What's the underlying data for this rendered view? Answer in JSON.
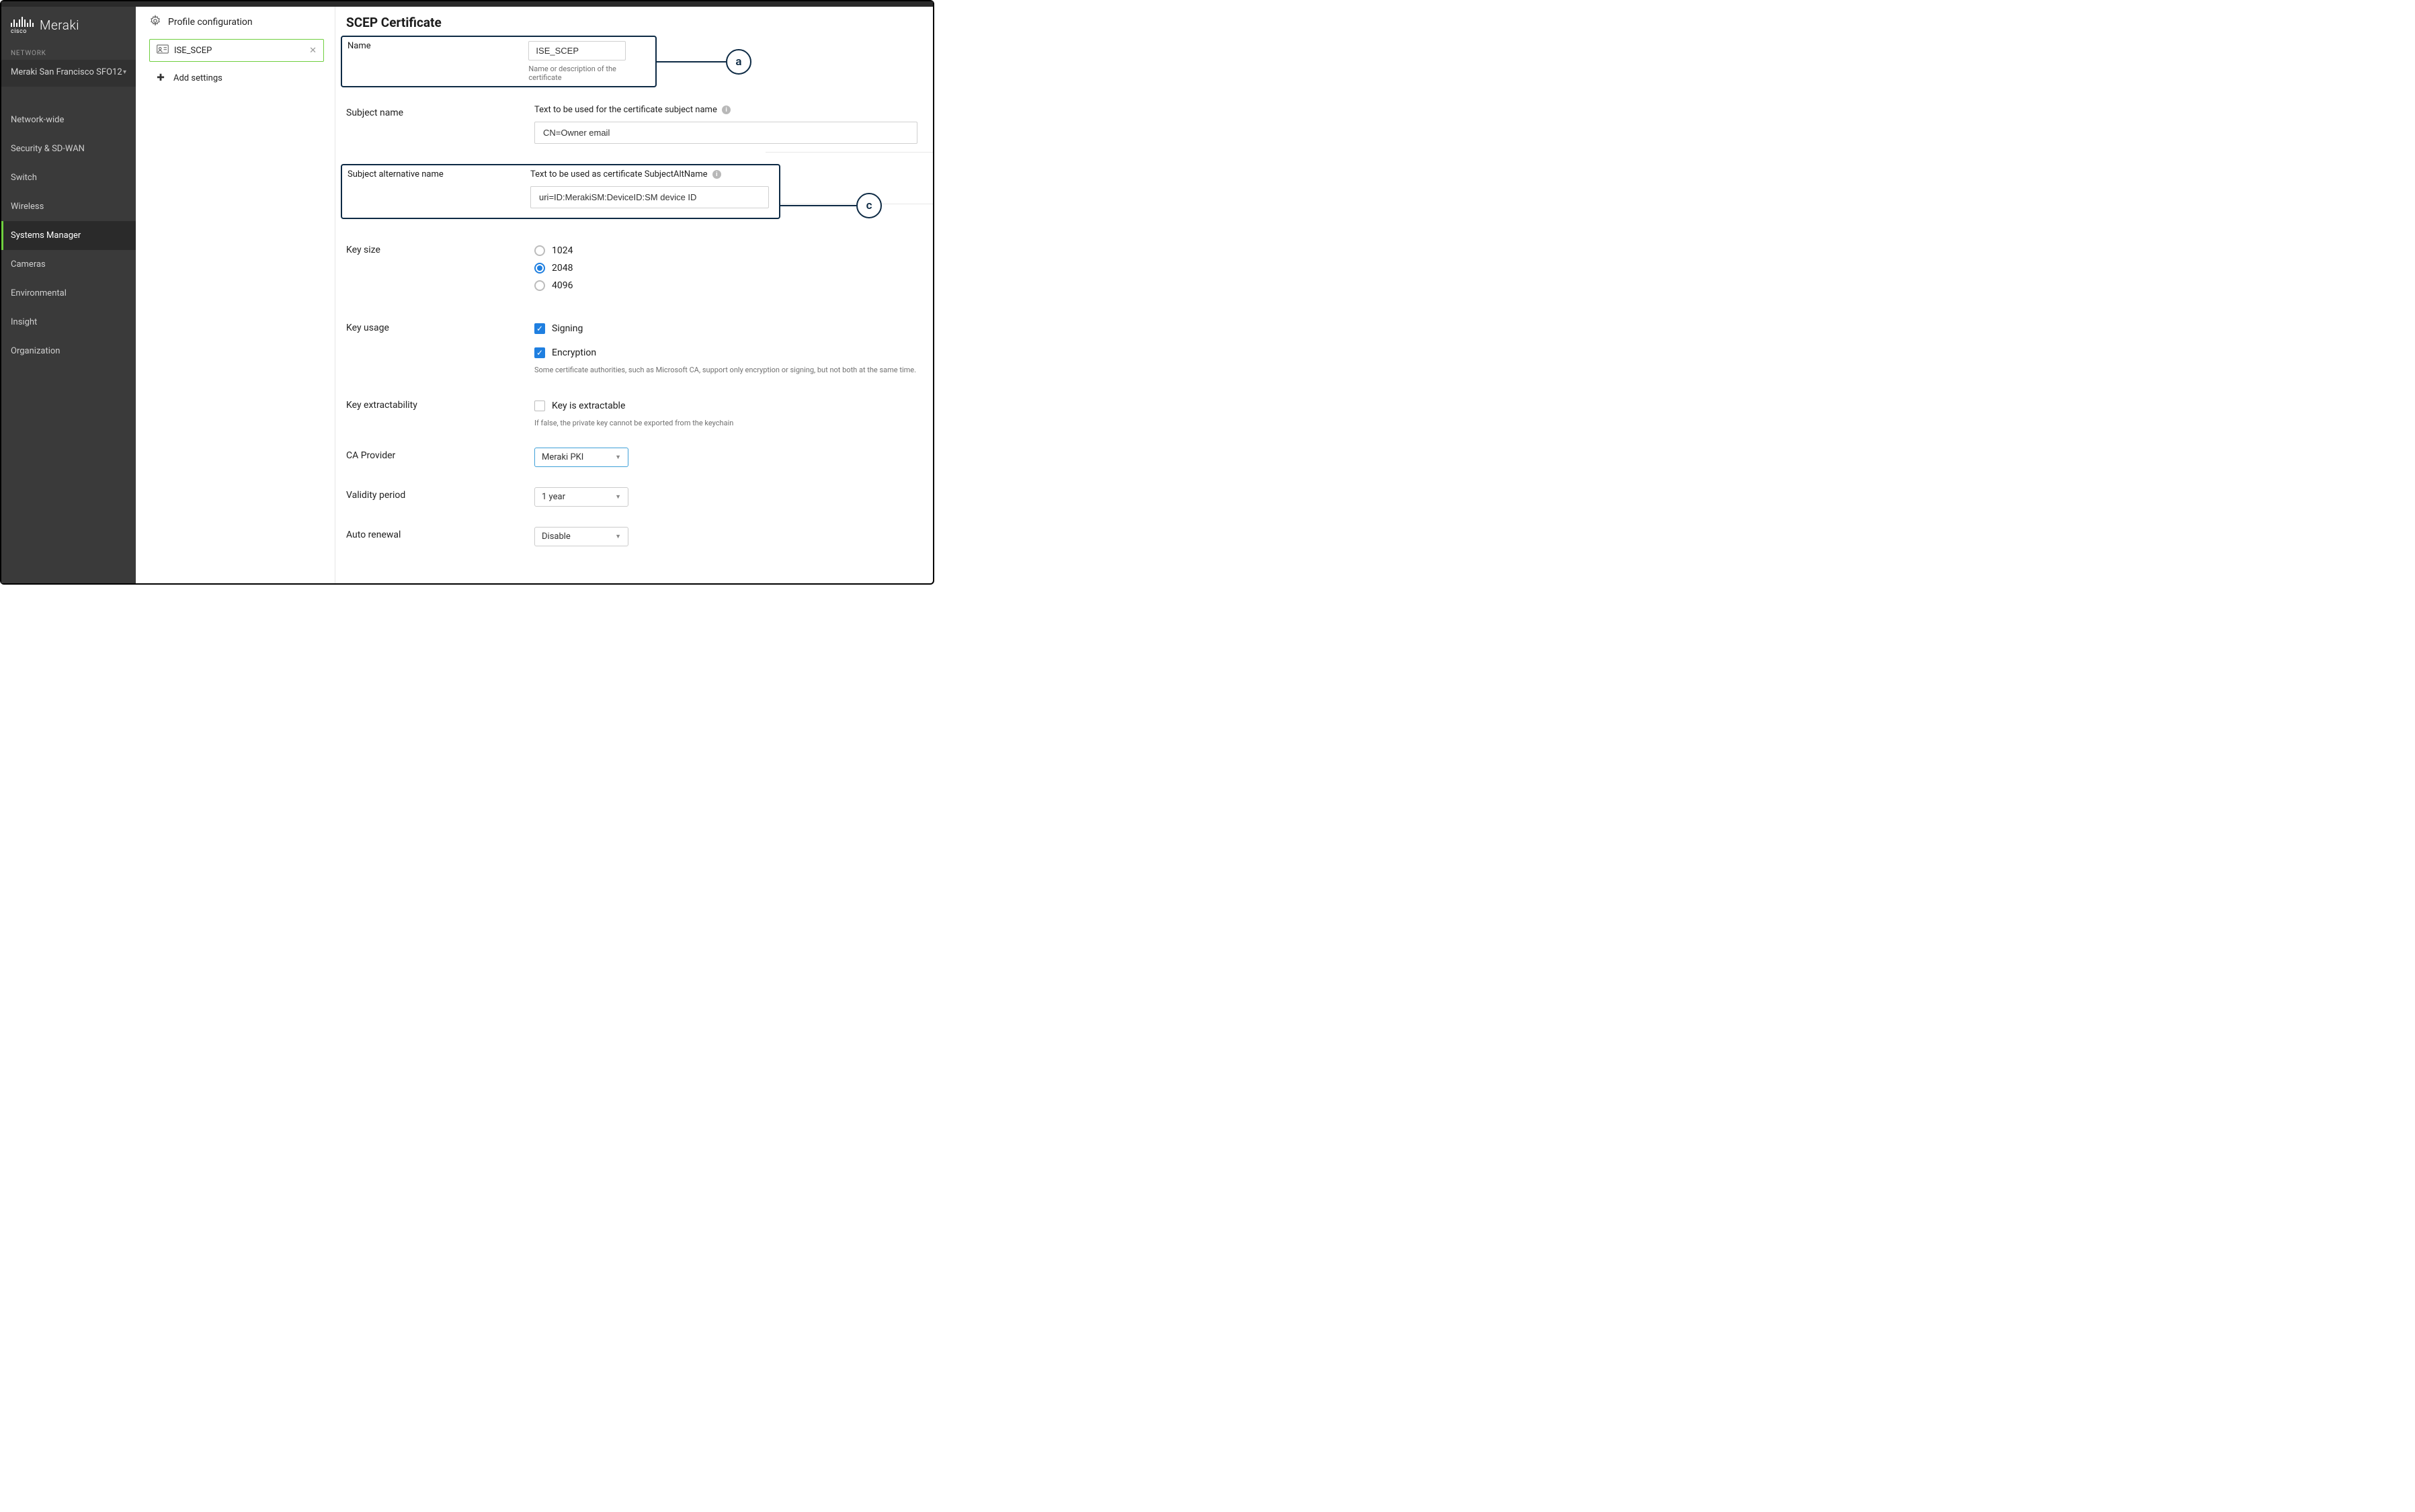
{
  "logo": {
    "brand": "Meraki",
    "vendor": "cisco"
  },
  "sidebar": {
    "network_label": "NETWORK",
    "network_name": "Meraki San Francisco SFO12",
    "items": [
      {
        "label": "Network-wide"
      },
      {
        "label": "Security & SD-WAN"
      },
      {
        "label": "Switch"
      },
      {
        "label": "Wireless"
      },
      {
        "label": "Systems Manager"
      },
      {
        "label": "Cameras"
      },
      {
        "label": "Environmental"
      },
      {
        "label": "Insight"
      },
      {
        "label": "Organization"
      }
    ]
  },
  "midcol": {
    "title": "Profile configuration",
    "profile": "ISE_SCEP",
    "add_settings": "Add settings"
  },
  "main": {
    "title": "SCEP Certificate"
  },
  "name_field": {
    "label": "Name",
    "value": "ISE_SCEP",
    "hint": "Name or description of the certificate"
  },
  "subject": {
    "label": "Subject name",
    "desc": "Text to be used for the certificate subject name",
    "value": "CN=Owner email"
  },
  "san": {
    "label": "Subject alternative name",
    "desc": "Text to be used as certificate SubjectAltName",
    "value": "uri=ID:MerakiSM:DeviceID:SM device ID"
  },
  "keysize": {
    "label": "Key size",
    "options": [
      "1024",
      "2048",
      "4096"
    ]
  },
  "keyusage": {
    "label": "Key usage",
    "signing": "Signing",
    "encryption": "Encryption",
    "hint": "Some certificate authorities, such as Microsoft CA, support only encryption or signing, but not both at the same time."
  },
  "extract": {
    "label": "Key extractability",
    "option": "Key is extractable",
    "hint": "If false, the private key cannot be exported from the keychain"
  },
  "ca": {
    "label": "CA Provider",
    "value": "Meraki PKI"
  },
  "validity": {
    "label": "Validity period",
    "value": "1 year"
  },
  "autorenew": {
    "label": "Auto renewal",
    "value": "Disable"
  },
  "callouts": {
    "a": "a",
    "c": "c"
  }
}
